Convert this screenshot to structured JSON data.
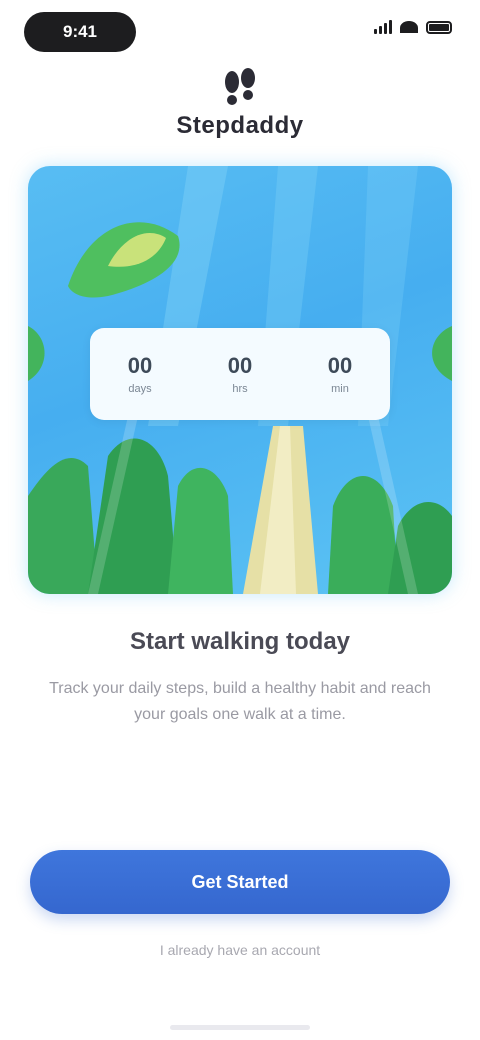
{
  "status_bar": {
    "time": "9:41"
  },
  "header": {
    "brand": "Stepdaddy"
  },
  "hero": {
    "counter": [
      {
        "value": "00",
        "unit": "days"
      },
      {
        "value": "00",
        "unit": "hrs"
      },
      {
        "value": "00",
        "unit": "min"
      }
    ]
  },
  "content": {
    "headline": "Start walking today",
    "body": "Track your daily steps, build a healthy habit and reach your goals one walk at a time."
  },
  "actions": {
    "primary_label": "Get Started",
    "secondary_label": "I already have an account"
  },
  "colors": {
    "accent": "#3567cf",
    "hero_sky": "#46aef0",
    "foliage": "#3cb36a",
    "path": "#e6e0a6"
  }
}
